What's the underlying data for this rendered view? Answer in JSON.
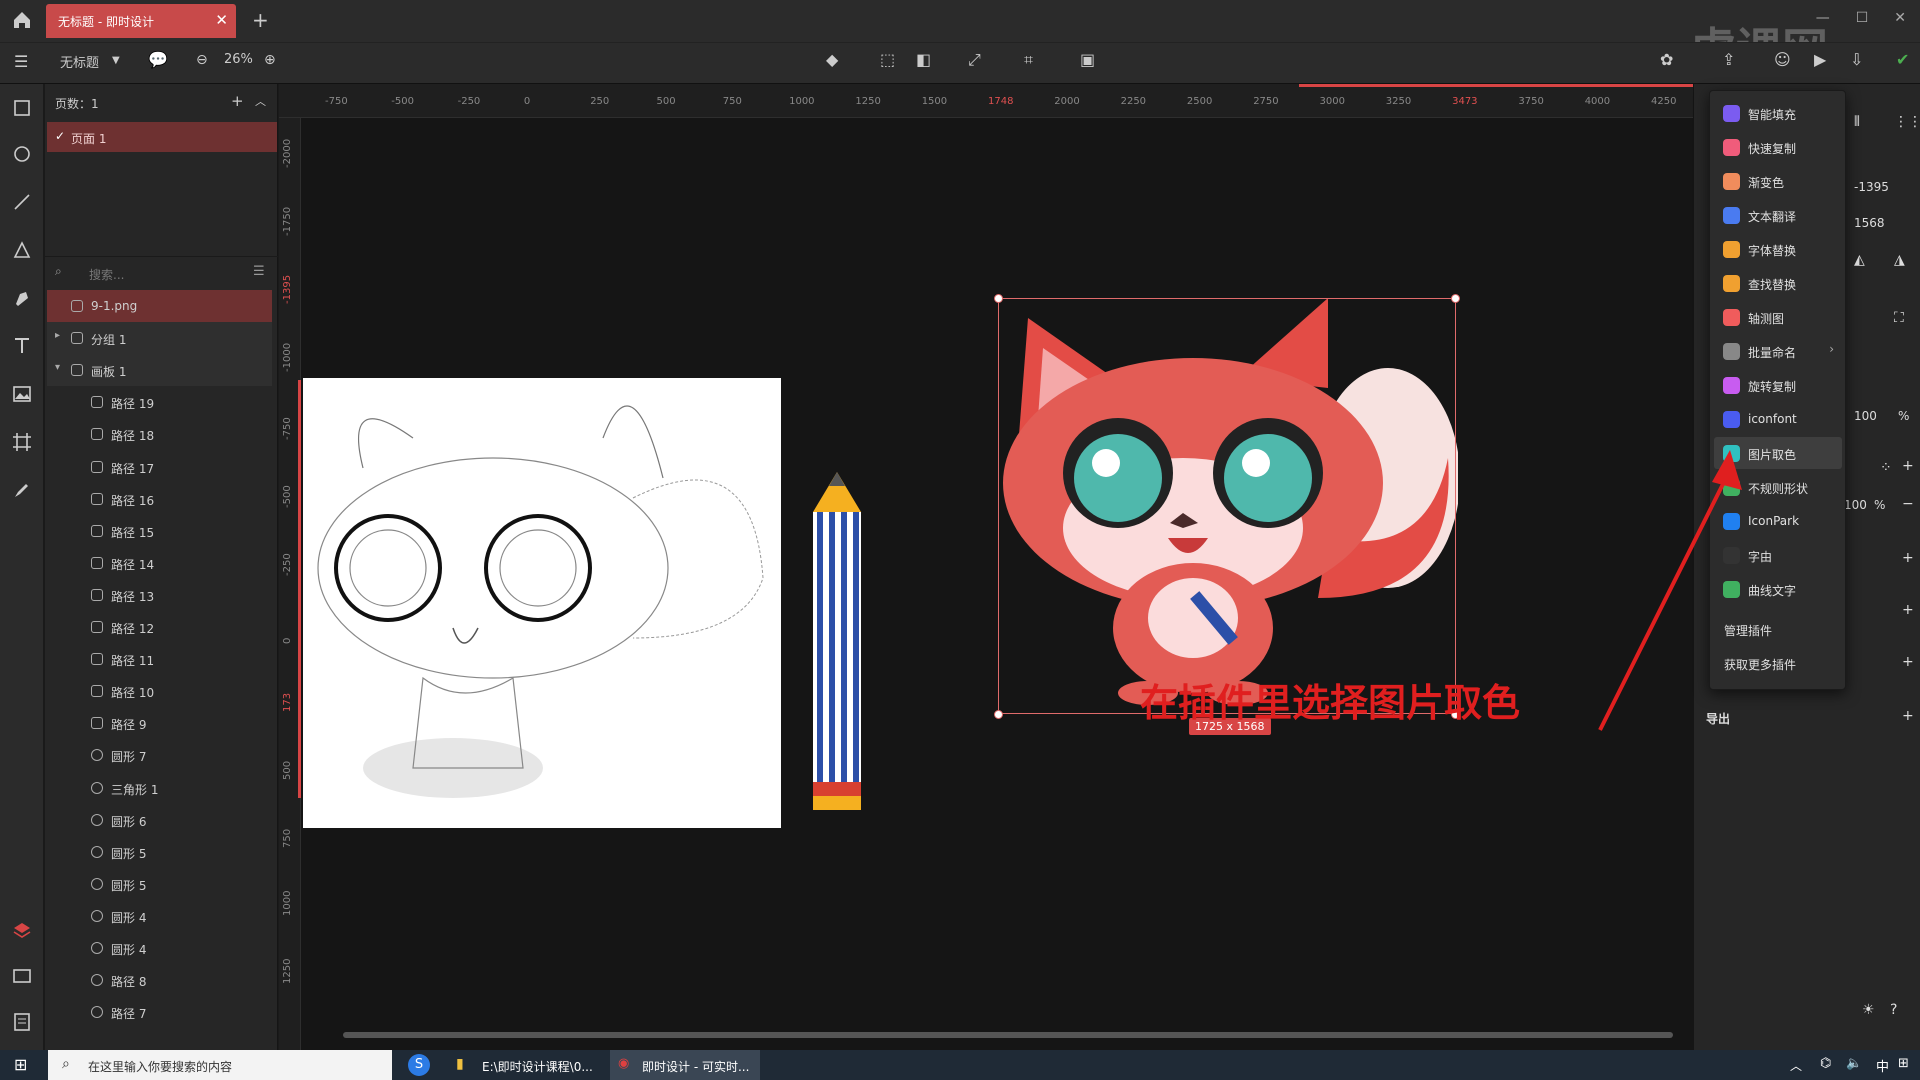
{
  "window": {
    "tab_title": "无标题 - 即时设计",
    "new_tab": "+",
    "watermark": "虎课网"
  },
  "toolbar": {
    "file_name": "无标题",
    "zoom": "26%"
  },
  "pages": {
    "header": "页数：1",
    "items": [
      {
        "label": "页面 1"
      }
    ]
  },
  "layers": {
    "search_placeholder": "搜索...",
    "items": [
      {
        "label": "9-1.png"
      },
      {
        "label": "分组 1"
      },
      {
        "label": "画板 1"
      },
      {
        "label": "路径 19"
      },
      {
        "label": "路径 18"
      },
      {
        "label": "路径 17"
      },
      {
        "label": "路径 16"
      },
      {
        "label": "路径 15"
      },
      {
        "label": "路径 14"
      },
      {
        "label": "路径 13"
      },
      {
        "label": "路径 12"
      },
      {
        "label": "路径 11"
      },
      {
        "label": "路径 10"
      },
      {
        "label": "路径 9"
      },
      {
        "label": "圆形 7"
      },
      {
        "label": "三角形 1"
      },
      {
        "label": "圆形 6"
      },
      {
        "label": "圆形 5"
      },
      {
        "label": "圆形 5"
      },
      {
        "label": "圆形 4"
      },
      {
        "label": "圆形 4"
      },
      {
        "label": "路径 8"
      },
      {
        "label": "路径 7"
      }
    ]
  },
  "rulers": {
    "top": [
      "-750",
      "-500",
      "-250",
      "0",
      "250",
      "500",
      "750",
      "1000",
      "1250",
      "1500",
      "1748",
      "2000",
      "2250",
      "2500",
      "2750",
      "3000",
      "3250",
      "3473",
      "3750",
      "4000",
      "4250"
    ],
    "left": [
      "-2000",
      "-1750",
      "-1395",
      "-1000",
      "-750",
      "-500",
      "-250",
      "0",
      "173",
      "500",
      "750",
      "1000",
      "1250"
    ]
  },
  "selection": {
    "size": "1725 x 1568"
  },
  "properties": {
    "x": "-1395",
    "y": "1568",
    "opacity": "100",
    "opacity_unit": "%",
    "fill_opacity": "100",
    "fill_unit": "%",
    "export_label": "导出"
  },
  "plugin_menu": {
    "items": [
      {
        "label": "智能填充",
        "color": "#7b5cf0"
      },
      {
        "label": "快速复制",
        "color": "#f05c7b"
      },
      {
        "label": "渐变色",
        "color": "#f08c5c"
      },
      {
        "label": "文本翻译",
        "color": "#4a7bf0"
      },
      {
        "label": "字体替换",
        "color": "#f0a030"
      },
      {
        "label": "查找替换",
        "color": "#f0a030"
      },
      {
        "label": "轴测图",
        "color": "#f05c5c"
      },
      {
        "label": "批量命名",
        "color": "#888888"
      },
      {
        "label": "旋转复制",
        "color": "#c85cf0"
      },
      {
        "label": "iconfont",
        "color": "#4a5cf0"
      },
      {
        "label": "图片取色",
        "color": "#30c0c0"
      },
      {
        "label": "不规则形状",
        "color": "#40b060"
      },
      {
        "label": "IconPark",
        "color": "#2080f0"
      },
      {
        "label": "字由",
        "color": "#333333"
      },
      {
        "label": "曲线文字",
        "color": "#40b060"
      }
    ],
    "manage": "管理插件",
    "more": "获取更多插件"
  },
  "annotation": "在插件里选择图片取色",
  "taskbar": {
    "search_placeholder": "在这里输入你要搜索的内容",
    "app1": "E:\\即时设计课程\\0...",
    "app2": "即时设计 - 可实时..."
  }
}
